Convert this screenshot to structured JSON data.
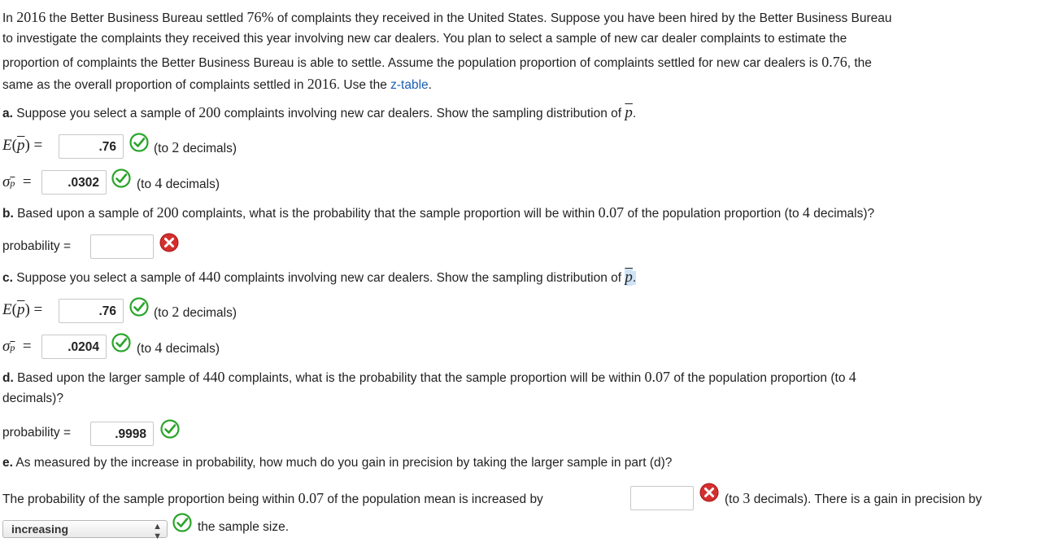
{
  "intro": {
    "l1a": "In ",
    "year1": "2016",
    "l1b": " the Better Business Bureau settled ",
    "pct": "76%",
    "l1c": " of complaints they received in the United States. Suppose you have been hired by the Better Business Bureau",
    "l2": "to investigate the complaints they received this year involving new car dealers. You plan to select a sample of new car dealer complaints to estimate the",
    "l3a": "proportion of complaints the Better Business Bureau is able to settle. Assume the population proportion of complaints settled for new car dealers is ",
    "p": "0.76",
    "l3b": ", the",
    "l4a": "same as the overall proportion of complaints settled in ",
    "year2": "2016",
    "l4b": ". Use the ",
    "ztable_link": "z-table",
    "l4c": "."
  },
  "part_a": {
    "label": "a.",
    "text_a": " Suppose you select a sample of ",
    "n": "200",
    "text_b": " complaints involving new car dealers. Show the sampling distribution of ",
    "pbar": "p",
    "text_c": ".",
    "e_label": "E(p) =",
    "e_value": ".76",
    "e_hint_a": "(to ",
    "e_hint_n": "2",
    "e_hint_b": " decimals)",
    "sigma_label": "σp =",
    "sigma_value": ".0302",
    "sigma_hint_a": "(to ",
    "sigma_hint_n": "4",
    "sigma_hint_b": " decimals)"
  },
  "part_b": {
    "label": "b.",
    "text_a": " Based upon a sample of ",
    "n": "200",
    "text_b": " complaints, what is the probability that the sample proportion will be within ",
    "within": "0.07",
    "text_c": " of the population proportion (to ",
    "dec": "4",
    "text_d": " decimals)?",
    "prob_label": "probability =",
    "prob_value": ""
  },
  "part_c": {
    "label": "c.",
    "text_a": " Suppose you select a sample of ",
    "n": "440",
    "text_b": " complaints involving new car dealers. Show the sampling distribution of ",
    "pbar": "p",
    "text_c": ".",
    "e_value": ".76",
    "e_hint_a": "(to ",
    "e_hint_n": "2",
    "e_hint_b": " decimals)",
    "sigma_value": ".0204",
    "sigma_hint_a": "(to ",
    "sigma_hint_n": "4",
    "sigma_hint_b": " decimals)"
  },
  "part_d": {
    "label": "d.",
    "text_a": " Based upon the larger sample of ",
    "n": "440",
    "text_b": " complaints, what is the probability that the sample proportion will be within ",
    "within": "0.07",
    "text_c": " of the population proportion (to ",
    "dec": "4",
    "text_d": "decimals)?",
    "prob_label": "probability =",
    "prob_value": ".9998"
  },
  "part_e": {
    "label": "e.",
    "text": " As measured by the increase in probability, how much do you gain in precision by taking the larger sample in part (d)?",
    "sent_a": "The probability of the sample proportion being within ",
    "within": "0.07",
    "sent_b": " of the population mean is increased by",
    "increase_value": "",
    "hint_a": "(to ",
    "hint_n": "3",
    "hint_b": " decimals). There is a gain in precision by",
    "select_value": "increasing",
    "tail": "the sample size."
  },
  "colors": {
    "correct": "#2aa52a",
    "incorrect": "#d32f2f",
    "link": "#1a5fb4"
  }
}
